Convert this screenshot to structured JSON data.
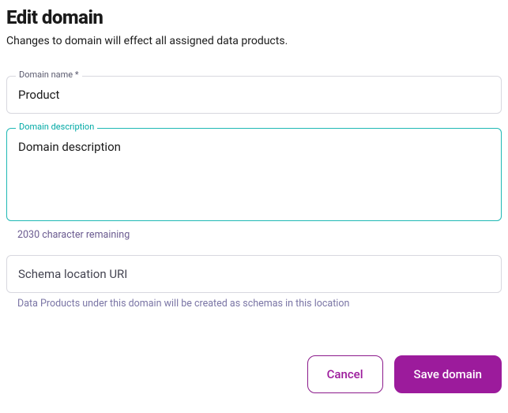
{
  "header": {
    "title": "Edit domain",
    "subtitle": "Changes to domain will effect all assigned data products."
  },
  "fields": {
    "name": {
      "label": "Domain name *",
      "value": "Product"
    },
    "description": {
      "label": "Domain description",
      "value": "Domain description",
      "helper": "2030 character remaining"
    },
    "schema": {
      "placeholder": "Schema location URI",
      "helper": "Data Products under this domain will be created as schemas in this location"
    }
  },
  "buttons": {
    "cancel": "Cancel",
    "save": "Save domain"
  }
}
